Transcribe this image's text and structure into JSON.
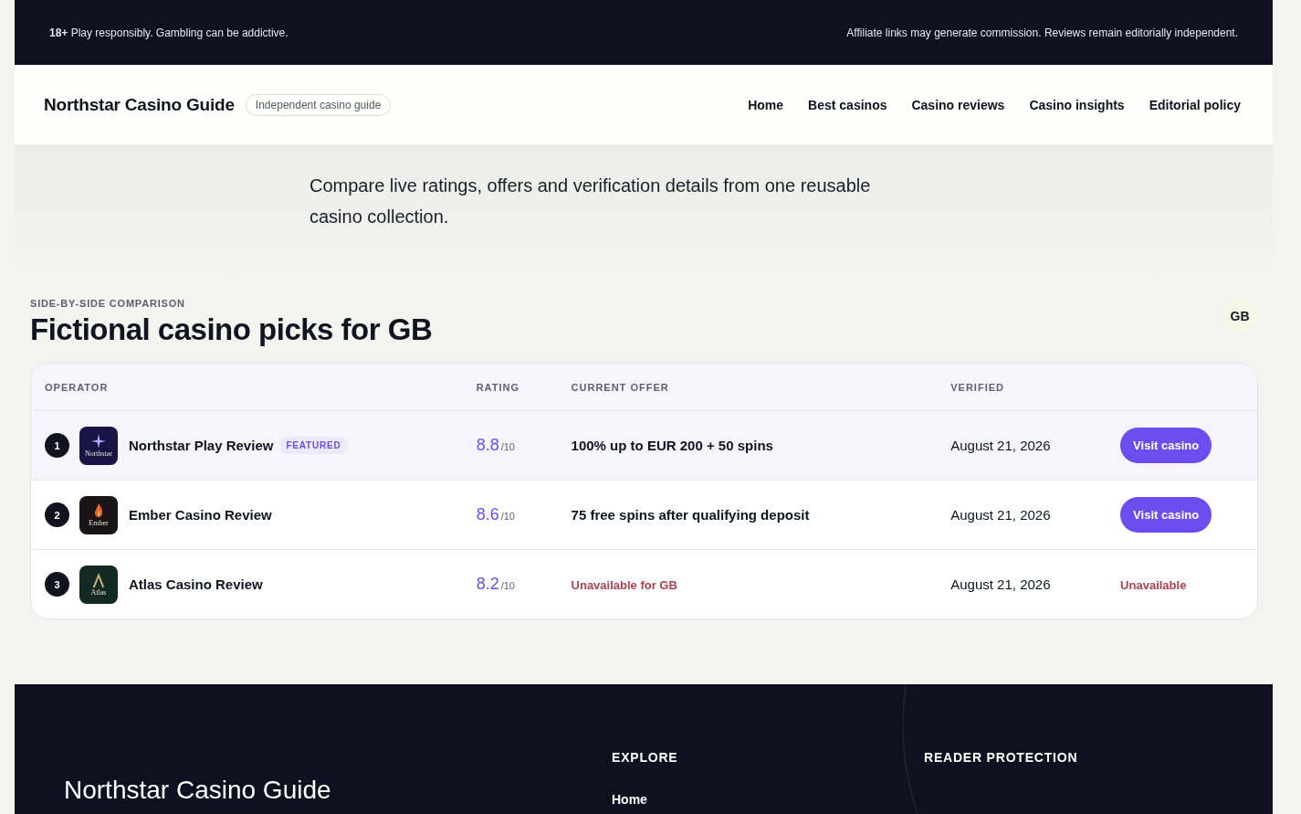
{
  "top_bar": {
    "age": "18+",
    "notice": "Play responsibly. Gambling can be addictive.",
    "disclosure": "Affiliate links may generate commission. Reviews remain editorially independent."
  },
  "header": {
    "brand": "Northstar Casino Guide",
    "tagline": "Independent casino guide",
    "nav": [
      "Home",
      "Best casinos",
      "Casino reviews",
      "Casino insights",
      "Editorial policy"
    ]
  },
  "hero": {
    "text": "Compare live ratings, offers and verification details from one reusable casino collection."
  },
  "comparison": {
    "eyebrow": "SIDE-BY-SIDE COMPARISON",
    "title": "Fictional casino picks for GB",
    "region": "GB",
    "columns": [
      "OPERATOR",
      "RATING",
      "CURRENT OFFER",
      "VERIFIED"
    ],
    "rows": [
      {
        "rank": "1",
        "kind": "star",
        "logo_text": "Northstar",
        "name": "Northstar Play Review",
        "featured": true,
        "badge": "FEATURED",
        "rating": "8.8",
        "scale": "/10",
        "offer": "100% up to EUR 200 + 50 spins",
        "available": true,
        "verified": "August 21, 2026",
        "action": "Visit casino"
      },
      {
        "rank": "2",
        "kind": "flame",
        "logo_text": "Ember",
        "name": "Ember Casino Review",
        "featured": false,
        "rating": "8.6",
        "scale": "/10",
        "offer": "75 free spins after qualifying deposit",
        "available": true,
        "verified": "August 21, 2026",
        "action": "Visit casino"
      },
      {
        "rank": "3",
        "kind": "peak",
        "logo_text": "Atlas",
        "name": "Atlas Casino Review",
        "featured": false,
        "rating": "8.2",
        "scale": "/10",
        "offer": "Unavailable for GB",
        "available": false,
        "verified": "August 21, 2026",
        "action": "Unavailable"
      }
    ]
  },
  "footer": {
    "brand": "Northstar Casino Guide",
    "columns": [
      {
        "title": "EXPLORE",
        "links": [
          "Home"
        ]
      },
      {
        "title": "READER PROTECTION"
      }
    ]
  }
}
